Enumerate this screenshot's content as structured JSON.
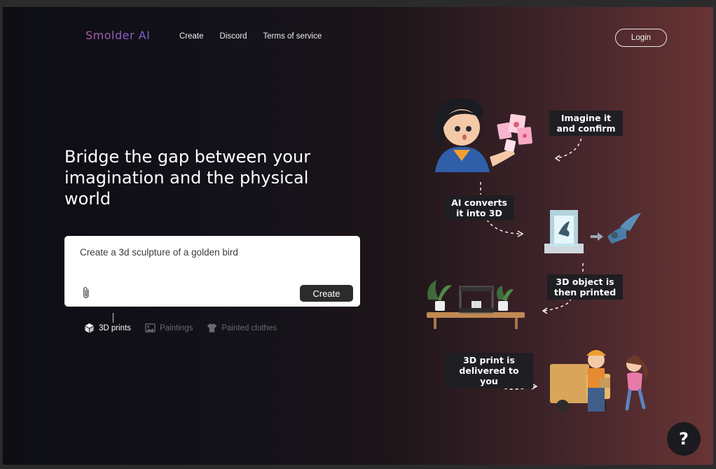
{
  "brand": {
    "name": "Smolder AI"
  },
  "nav": {
    "items": [
      "Create",
      "Discord",
      "Terms of service"
    ],
    "login_label": "Login"
  },
  "hero": {
    "title": "Bridge the gap between your imagination and the physical world"
  },
  "prompt": {
    "value": "Create a 3d sculpture of a golden bird",
    "create_label": "Create"
  },
  "tabs": [
    {
      "label": "3D prints",
      "icon": "cube-icon",
      "active": true
    },
    {
      "label": "Paintings",
      "icon": "image-icon",
      "active": false
    },
    {
      "label": "Painted clothes",
      "icon": "tshirt-icon",
      "active": false
    }
  ],
  "steps": [
    {
      "label": "Imagine it and confirm"
    },
    {
      "label": "AI converts it into 3D"
    },
    {
      "label": "3D object is then printed"
    },
    {
      "label": "3D print is delivered to you"
    }
  ],
  "help": {
    "label": "?"
  }
}
